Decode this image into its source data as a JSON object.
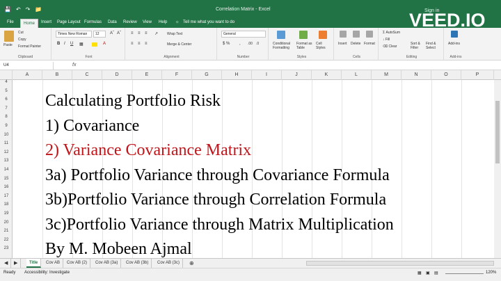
{
  "window": {
    "title": "Correlation Matrix - Excel",
    "signin": "Sign in",
    "watermark": "VEED.IO",
    "colors": {
      "excel_green": "#217346",
      "red_text": "#c0151b"
    }
  },
  "qat": {
    "save_icon": "save-icon",
    "undo_icon": "undo-icon",
    "redo_icon": "redo-icon",
    "open_icon": "folder-icon"
  },
  "tabs": [
    "File",
    "Home",
    "Insert",
    "Page Layout",
    "Formulas",
    "Data",
    "Review",
    "View",
    "Help"
  ],
  "tellme": "Tell me what you want to do",
  "ribbon": {
    "clipboard": {
      "paste": "Paste",
      "cut": "Cut",
      "copy": "Copy",
      "format_painter": "Format Painter",
      "label": "Clipboard"
    },
    "font": {
      "name": "Times New Roman",
      "size": "12",
      "label": "Font"
    },
    "alignment": {
      "wrap": "Wrap Text",
      "merge": "Merge & Center",
      "label": "Alignment"
    },
    "number": {
      "format": "General",
      "label": "Number"
    },
    "styles": {
      "conditional": "Conditional Formatting",
      "table": "Format as Table",
      "cell": "Cell Styles",
      "label": "Styles"
    },
    "cells": {
      "insert": "Insert",
      "delete": "Delete",
      "format": "Format",
      "label": "Cells"
    },
    "editing": {
      "autosum": "AutoSum",
      "fill": "Fill",
      "clear": "Clear",
      "sort": "Sort & Filter",
      "find": "Find & Select",
      "label": "Editing"
    },
    "addins": {
      "addins": "Add-ins",
      "label": "Add-ins"
    }
  },
  "formula_bar": {
    "name_box": "U4",
    "fx": "fx",
    "value": ""
  },
  "columns": [
    "A",
    "B",
    "C",
    "D",
    "E",
    "F",
    "G",
    "H",
    "I",
    "J",
    "K",
    "L",
    "M",
    "N",
    "O",
    "P"
  ],
  "rows": [
    "4",
    "5",
    "6",
    "7",
    "8",
    "9",
    "10",
    "11",
    "12",
    "13",
    "14",
    "15",
    "16",
    "17",
    "18",
    "19",
    "20",
    "21",
    "22",
    "23"
  ],
  "content": {
    "line1": "Calculating Portfolio Risk",
    "line2": "1) Covariance",
    "line3": "2) Variance Covariance Matrix",
    "line4": "3a) Portfolio Variance through Covariance Formula",
    "line5": "3b)Portfolio Variance through Correlation Formula",
    "line6": "3c)Portfolio Variance through Matrix Multiplication",
    "line7": "By M. Mobeen Ajmal"
  },
  "sheets": [
    "Title",
    "Cov AB",
    "Cov AB (2)",
    "Cov AB (3a)",
    "Cov AB (3b)",
    "Cov AB (3c)"
  ],
  "active_sheet": "Title",
  "status": {
    "ready": "Ready",
    "accessibility": "Accessibility: Investigate",
    "zoom": "120%"
  }
}
